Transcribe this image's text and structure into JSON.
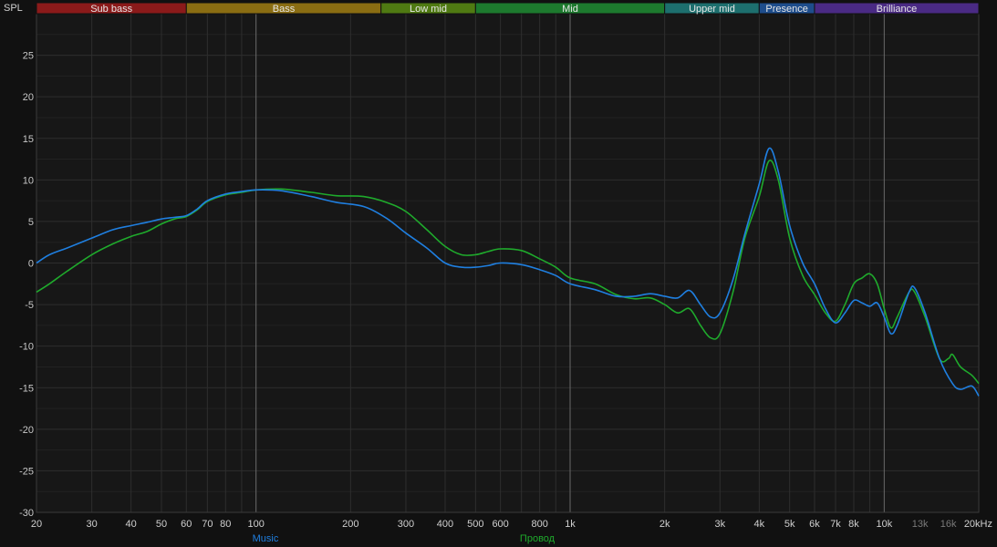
{
  "chart_data": {
    "type": "line",
    "ylabel": "SPL",
    "x_scale": "log",
    "xlim": [
      20,
      20000
    ],
    "ylim": [
      -30,
      30
    ],
    "y_ticks": [
      -30,
      -25,
      -20,
      -15,
      -10,
      -5,
      0,
      5,
      10,
      15,
      20,
      25
    ],
    "x_ticks": [
      {
        "v": 20,
        "label": "20"
      },
      {
        "v": 30,
        "label": "30"
      },
      {
        "v": 40,
        "label": "40"
      },
      {
        "v": 50,
        "label": "50"
      },
      {
        "v": 60,
        "label": "60"
      },
      {
        "v": 70,
        "label": "70"
      },
      {
        "v": 80,
        "label": "80"
      },
      {
        "v": 100,
        "label": "100"
      },
      {
        "v": 200,
        "label": "200"
      },
      {
        "v": 300,
        "label": "300"
      },
      {
        "v": 400,
        "label": "400"
      },
      {
        "v": 500,
        "label": "500"
      },
      {
        "v": 600,
        "label": "600"
      },
      {
        "v": 800,
        "label": "800"
      },
      {
        "v": 1000,
        "label": "1k"
      },
      {
        "v": 2000,
        "label": "2k"
      },
      {
        "v": 3000,
        "label": "3k"
      },
      {
        "v": 4000,
        "label": "4k"
      },
      {
        "v": 5000,
        "label": "5k"
      },
      {
        "v": 6000,
        "label": "6k"
      },
      {
        "v": 7000,
        "label": "7k"
      },
      {
        "v": 8000,
        "label": "8k"
      },
      {
        "v": 10000,
        "label": "10k"
      },
      {
        "v": 13000,
        "label": "13k",
        "dim": true
      },
      {
        "v": 16000,
        "label": "16k",
        "dim": true
      },
      {
        "v": 20000,
        "label": "20kHz"
      }
    ],
    "grid": true,
    "major_vlines": [
      100,
      1000,
      10000
    ],
    "bands": [
      {
        "name": "Sub bass",
        "from": 20,
        "to": 60,
        "color": "#8b1a1a"
      },
      {
        "name": "Bass",
        "from": 60,
        "to": 250,
        "color": "#8a6d12"
      },
      {
        "name": "Low mid",
        "from": 250,
        "to": 500,
        "color": "#4f7a12"
      },
      {
        "name": "Mid",
        "from": 500,
        "to": 2000,
        "color": "#1d7a2e"
      },
      {
        "name": "Upper mid",
        "from": 2000,
        "to": 4000,
        "color": "#1d6f6e"
      },
      {
        "name": "Presence",
        "from": 4000,
        "to": 6000,
        "color": "#1e4d8c"
      },
      {
        "name": "Brilliance",
        "from": 6000,
        "to": 20000,
        "color": "#4a2a84"
      }
    ],
    "legend_position": "bottom-center",
    "series": [
      {
        "name": "Music",
        "color": "#1f7fe0",
        "points": [
          [
            20,
            0.0
          ],
          [
            22,
            1.0
          ],
          [
            25,
            1.8
          ],
          [
            30,
            3.0
          ],
          [
            35,
            4.0
          ],
          [
            40,
            4.5
          ],
          [
            45,
            4.9
          ],
          [
            50,
            5.3
          ],
          [
            55,
            5.5
          ],
          [
            60,
            5.7
          ],
          [
            65,
            6.5
          ],
          [
            70,
            7.5
          ],
          [
            80,
            8.3
          ],
          [
            90,
            8.6
          ],
          [
            100,
            8.8
          ],
          [
            120,
            8.7
          ],
          [
            150,
            8.0
          ],
          [
            180,
            7.3
          ],
          [
            220,
            6.8
          ],
          [
            260,
            5.4
          ],
          [
            300,
            3.6
          ],
          [
            350,
            1.8
          ],
          [
            400,
            0.0
          ],
          [
            450,
            -0.5
          ],
          [
            500,
            -0.5
          ],
          [
            550,
            -0.3
          ],
          [
            600,
            0.0
          ],
          [
            700,
            -0.2
          ],
          [
            800,
            -0.8
          ],
          [
            900,
            -1.5
          ],
          [
            1000,
            -2.5
          ],
          [
            1200,
            -3.2
          ],
          [
            1400,
            -4.0
          ],
          [
            1600,
            -4.0
          ],
          [
            1800,
            -3.7
          ],
          [
            2000,
            -4.0
          ],
          [
            2200,
            -4.2
          ],
          [
            2400,
            -3.3
          ],
          [
            2600,
            -5.0
          ],
          [
            2800,
            -6.5
          ],
          [
            3000,
            -6.0
          ],
          [
            3300,
            -2.0
          ],
          [
            3600,
            3.5
          ],
          [
            4000,
            9.5
          ],
          [
            4300,
            13.8
          ],
          [
            4600,
            11.0
          ],
          [
            5000,
            4.5
          ],
          [
            5500,
            0.0
          ],
          [
            6000,
            -2.5
          ],
          [
            6500,
            -5.5
          ],
          [
            7000,
            -7.2
          ],
          [
            7500,
            -6.0
          ],
          [
            8000,
            -4.5
          ],
          [
            8500,
            -4.8
          ],
          [
            9000,
            -5.2
          ],
          [
            9500,
            -4.8
          ],
          [
            10000,
            -6.5
          ],
          [
            10500,
            -8.5
          ],
          [
            11000,
            -7.5
          ],
          [
            12000,
            -3.5
          ],
          [
            12500,
            -3.0
          ],
          [
            13500,
            -6.0
          ],
          [
            15000,
            -11.5
          ],
          [
            16500,
            -14.5
          ],
          [
            17500,
            -15.2
          ],
          [
            19000,
            -14.8
          ],
          [
            20000,
            -16.0
          ]
        ]
      },
      {
        "name": "Провод",
        "color": "#1faa2c",
        "points": [
          [
            20,
            -3.5
          ],
          [
            22,
            -2.5
          ],
          [
            25,
            -1.0
          ],
          [
            30,
            1.0
          ],
          [
            35,
            2.3
          ],
          [
            40,
            3.2
          ],
          [
            45,
            3.8
          ],
          [
            50,
            4.7
          ],
          [
            55,
            5.3
          ],
          [
            60,
            5.6
          ],
          [
            65,
            6.4
          ],
          [
            70,
            7.4
          ],
          [
            80,
            8.2
          ],
          [
            90,
            8.5
          ],
          [
            100,
            8.8
          ],
          [
            120,
            8.9
          ],
          [
            150,
            8.5
          ],
          [
            180,
            8.1
          ],
          [
            220,
            8.0
          ],
          [
            260,
            7.3
          ],
          [
            300,
            6.2
          ],
          [
            350,
            4.0
          ],
          [
            400,
            2.0
          ],
          [
            450,
            1.0
          ],
          [
            500,
            1.0
          ],
          [
            550,
            1.4
          ],
          [
            600,
            1.7
          ],
          [
            700,
            1.5
          ],
          [
            800,
            0.5
          ],
          [
            900,
            -0.5
          ],
          [
            1000,
            -1.8
          ],
          [
            1200,
            -2.5
          ],
          [
            1400,
            -3.8
          ],
          [
            1600,
            -4.3
          ],
          [
            1800,
            -4.2
          ],
          [
            2000,
            -5.0
          ],
          [
            2200,
            -6.0
          ],
          [
            2400,
            -5.5
          ],
          [
            2600,
            -7.5
          ],
          [
            2800,
            -9.0
          ],
          [
            3000,
            -8.5
          ],
          [
            3300,
            -3.5
          ],
          [
            3600,
            3.0
          ],
          [
            4000,
            8.0
          ],
          [
            4300,
            12.3
          ],
          [
            4600,
            10.0
          ],
          [
            5000,
            3.0
          ],
          [
            5500,
            -1.5
          ],
          [
            6000,
            -3.8
          ],
          [
            6500,
            -6.0
          ],
          [
            7000,
            -7.0
          ],
          [
            7500,
            -5.0
          ],
          [
            8000,
            -2.5
          ],
          [
            8500,
            -1.8
          ],
          [
            9000,
            -1.3
          ],
          [
            9500,
            -2.5
          ],
          [
            10000,
            -5.5
          ],
          [
            10500,
            -7.8
          ],
          [
            11000,
            -6.5
          ],
          [
            12000,
            -3.5
          ],
          [
            12500,
            -3.5
          ],
          [
            13500,
            -6.5
          ],
          [
            15000,
            -11.5
          ],
          [
            16000,
            -11.5
          ],
          [
            16500,
            -11.0
          ],
          [
            17500,
            -12.5
          ],
          [
            19000,
            -13.5
          ],
          [
            20000,
            -14.5
          ]
        ]
      }
    ]
  }
}
